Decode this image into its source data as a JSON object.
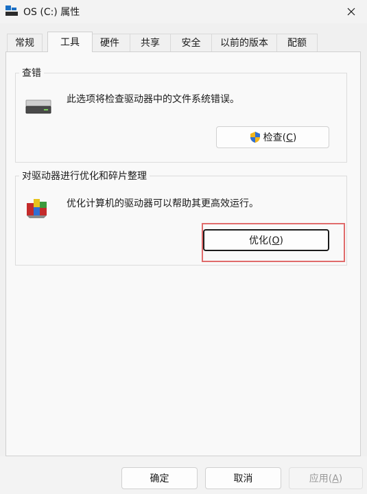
{
  "window": {
    "title": "OS (C:) 属性"
  },
  "tabs": [
    "常规",
    "工具",
    "硬件",
    "共享",
    "安全",
    "以前的版本",
    "配额"
  ],
  "active_tab": "工具",
  "error_check": {
    "label": "查错",
    "description": "此选项将检查驱动器中的文件系统错误。",
    "button_text": "检查(",
    "button_key": "C",
    "button_close": ")"
  },
  "optimize": {
    "label": "对驱动器进行优化和碎片整理",
    "description": "优化计算机的驱动器可以帮助其更高效运行。",
    "button_text": "优化(",
    "button_key": "O",
    "button_close": ")"
  },
  "footer": {
    "ok": "确定",
    "cancel": "取消",
    "apply_text": "应用(",
    "apply_key": "A",
    "apply_close": ")"
  }
}
